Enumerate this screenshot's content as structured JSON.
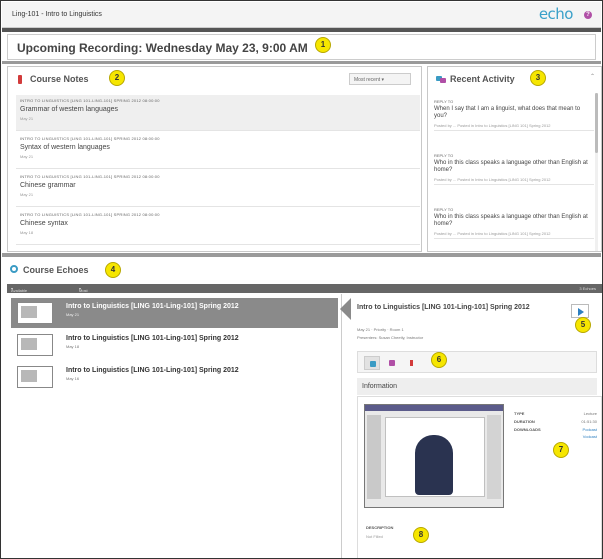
{
  "app": {
    "course_title": "Ling-101 - Intro to Linguistics",
    "brand": "echo",
    "help_icon": "question-icon",
    "brand_color": "#39a0c9"
  },
  "upcoming": {
    "text": "Upcoming Recording: Wednesday May 23, 9:00 AM"
  },
  "badges": [
    "1",
    "2",
    "3",
    "4",
    "5",
    "6",
    "7",
    "8"
  ],
  "course_notes": {
    "title": "Course Notes",
    "icon": "notes-icon",
    "sort_label": "Most recent",
    "items": [
      {
        "meta": "INTRO TO LINGUISTICS [LING 101-LING-101] SPRING 2012 08:00:00",
        "title": "Grammar of western languages",
        "date": "May 21"
      },
      {
        "meta": "INTRO TO LINGUISTICS [LING 101-LING-101] SPRING 2012 08:00:00",
        "title": "Syntax of western languages",
        "date": "May 21"
      },
      {
        "meta": "INTRO TO LINGUISTICS [LING 101-LING-101] SPRING 2012 08:00:00",
        "title": "Chinese grammar",
        "date": "May 21"
      },
      {
        "meta": "INTRO TO LINGUISTICS [LING 101-LING-101] SPRING 2012 08:00:00",
        "title": "Chinese syntax",
        "date": "May 18"
      }
    ]
  },
  "recent_activity": {
    "title": "Recent Activity",
    "icon": "chat-bubbles-icon",
    "items": [
      {
        "tag": "REPLY TO",
        "question": "When I say that I am a linguist, what does that mean to you?",
        "meta": "Posted by ...  Posted in Intro to Linguistics [LING 101] Spring 2012"
      },
      {
        "tag": "REPLY TO",
        "question": "Who in this class speaks a language other than English at home?",
        "meta": "Posted by ...  Posted in Intro to Linguistics [LING 101] Spring 2012"
      },
      {
        "tag": "REPLY TO",
        "question": "Who in this class speaks a language other than English at home?",
        "meta": "Posted by ...  Posted in Intro to Linguistics [LING 101] Spring 2012"
      }
    ]
  },
  "course_echoes": {
    "title": "Course Echoes",
    "icon": "echoes-icon",
    "filter_available": "Available",
    "filter_sort": "Most Recent",
    "count": "3 Echoes",
    "items": [
      {
        "title": "Intro to Linguistics [LING 101-Ling-101] Spring 2012",
        "date": "May 21"
      },
      {
        "title": "Intro to Linguistics [LING 101-Ling-101] Spring 2012",
        "date": "May 18"
      },
      {
        "title": "Intro to Linguistics [LING 101-Ling-101] Spring 2012",
        "date": "May 16"
      }
    ]
  },
  "detail": {
    "title": "Intro to Linguistics [LING 101-Ling-101] Spring 2012",
    "meta1": "May 21 · Priority · Room 1",
    "meta2": "Presenters: Susan Cheetly, Instructor",
    "play_icon": "play-icon",
    "tabs": [
      "info-icon",
      "chat-icon",
      "notes-icon"
    ],
    "info_heading": "Information",
    "type_label": "TYPE",
    "type_value": "Lecture",
    "duration_label": "DURATION",
    "duration_value": "01:51:30",
    "downloads_label": "DOWNLOADS",
    "downloads_link1": "Podcast",
    "downloads_link2": "Vodcast",
    "description_label": "DESCRIPTION",
    "description_value": "Not Filled"
  }
}
